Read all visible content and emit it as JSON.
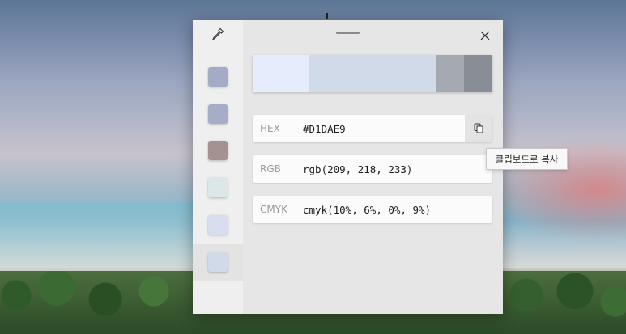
{
  "window": {
    "colors": {
      "background": "#e6e6e6",
      "sidebar": "#efefef"
    }
  },
  "history": {
    "swatches": [
      {
        "color": "#a4abc6"
      },
      {
        "color": "#a5adc8"
      },
      {
        "color": "#a39291"
      },
      {
        "color": "#dce8e8"
      },
      {
        "color": "#d8def0"
      },
      {
        "color": "#d1dae9"
      }
    ],
    "selected_index": 5
  },
  "shades_bar": {
    "segments": [
      {
        "color": "#e6ecfc"
      },
      {
        "color": "#d1dae9"
      },
      {
        "color": "#a4a9b2"
      },
      {
        "color": "#898e96"
      }
    ]
  },
  "formats": [
    {
      "label": "HEX",
      "value": "#D1DAE9"
    },
    {
      "label": "RGB",
      "value": "rgb(209, 218, 233)"
    },
    {
      "label": "CMYK",
      "value": "cmyk(10%, 6%, 0%, 9%)"
    }
  ],
  "tooltip": {
    "text": "클립보드로 복사"
  },
  "icons": {
    "picker": "eyedropper-icon",
    "close": "close-icon",
    "copy": "copy-icon"
  }
}
